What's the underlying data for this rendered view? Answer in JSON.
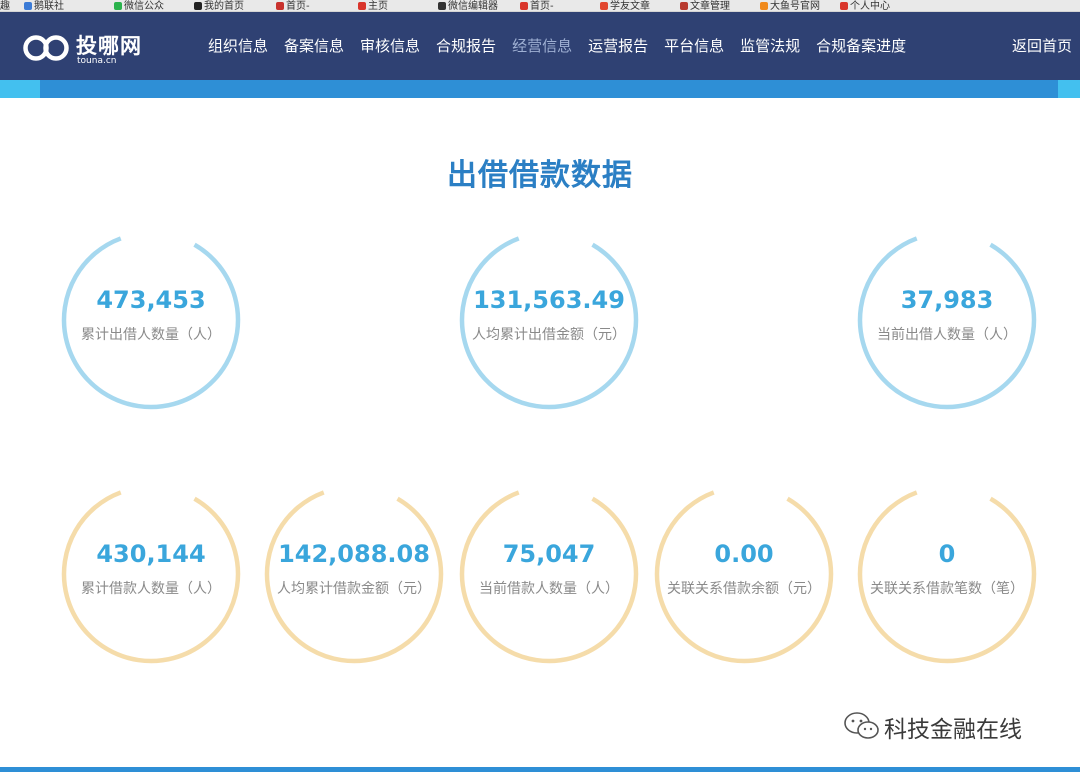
{
  "bookmarks": [
    "趣",
    "鹅联社",
    "微信公众",
    "我的首页",
    "首页-",
    "主页",
    "微信编辑器",
    "首页-",
    "学友文章",
    "文章管理",
    "大鱼号官网",
    "个人中心"
  ],
  "header": {
    "logo_name": "投哪网",
    "logo_domain": "touna.cn",
    "nav": [
      "组织信息",
      "备案信息",
      "审核信息",
      "合规报告",
      "经营信息",
      "运营报告",
      "平台信息",
      "监管法规",
      "合规备案进度"
    ],
    "active_nav": "经营信息",
    "back_home": "返回首页"
  },
  "page_title": "出借借款数据",
  "lender_stats": [
    {
      "value": "473,453",
      "label": "累计出借人数量（人）"
    },
    {
      "value": "131,563.49",
      "label": "人均累计出借金额（元）"
    },
    {
      "value": "37,983",
      "label": "当前出借人数量（人）"
    }
  ],
  "borrower_stats": [
    {
      "value": "430,144",
      "label": "累计借款人数量（人）"
    },
    {
      "value": "142,088.08",
      "label": "人均累计借款金额（元）"
    },
    {
      "value": "75,047",
      "label": "当前借款人数量（人）"
    },
    {
      "value": "0.00",
      "label": "关联关系借款余额（元）"
    },
    {
      "value": "0",
      "label": "关联关系借款笔数（笔）"
    }
  ],
  "colors": {
    "header_bg": "#2f4173",
    "band_light": "#43c0ef",
    "band_dark": "#2e8fd6",
    "title": "#2b7fc4",
    "value": "#3aa6dc",
    "lender_ring": "#a6d8ef",
    "borrower_ring": "#f5dcaa"
  },
  "watermark": "科技金融在线"
}
